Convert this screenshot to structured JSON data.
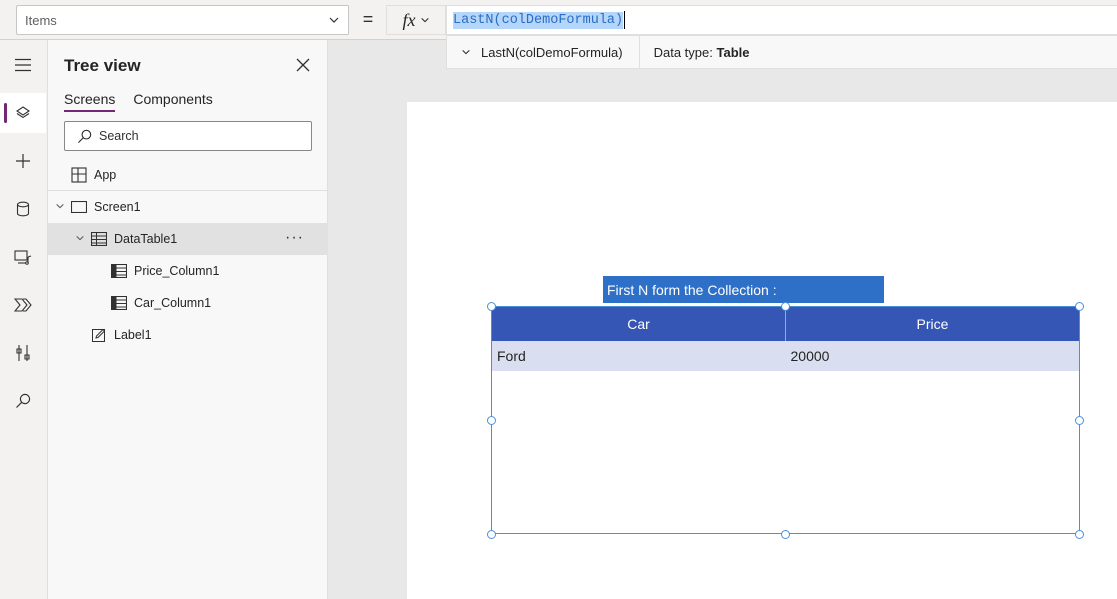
{
  "formula_bar": {
    "property": "Items",
    "equals": "=",
    "fx_label": "fx",
    "formula": "LastN(colDemoFormula)",
    "result_expression": "LastN(colDemoFormula)",
    "data_type_label": "Data type:",
    "data_type_value": "Table"
  },
  "rail": {
    "items": [
      "hamburger-icon",
      "layers-icon",
      "plus-icon",
      "database-icon",
      "media-icon",
      "power-automate-icon",
      "tools-icon",
      "search-icon"
    ],
    "accent_color": "#742774"
  },
  "tree": {
    "title": "Tree view",
    "tabs": [
      {
        "label": "Screens",
        "active": true
      },
      {
        "label": "Components",
        "active": false
      }
    ],
    "search_placeholder": "Search",
    "app_label": "App",
    "nodes": [
      {
        "label": "Screen1",
        "type": "screen",
        "expanded": true
      },
      {
        "label": "DataTable1",
        "type": "datatable",
        "expanded": true,
        "selected": true,
        "more": "···"
      },
      {
        "label": "Price_Column1",
        "type": "column"
      },
      {
        "label": "Car_Column1",
        "type": "column"
      },
      {
        "label": "Label1",
        "type": "label"
      }
    ]
  },
  "canvas": {
    "label_text": "First N form the Collection :",
    "label_color": "#2e6fc8",
    "table": {
      "columns": [
        "Car",
        "Price"
      ],
      "rows": [
        [
          "Ford",
          "20000"
        ]
      ],
      "header_color": "#3556b4",
      "row_color": "#d9dff0"
    }
  }
}
